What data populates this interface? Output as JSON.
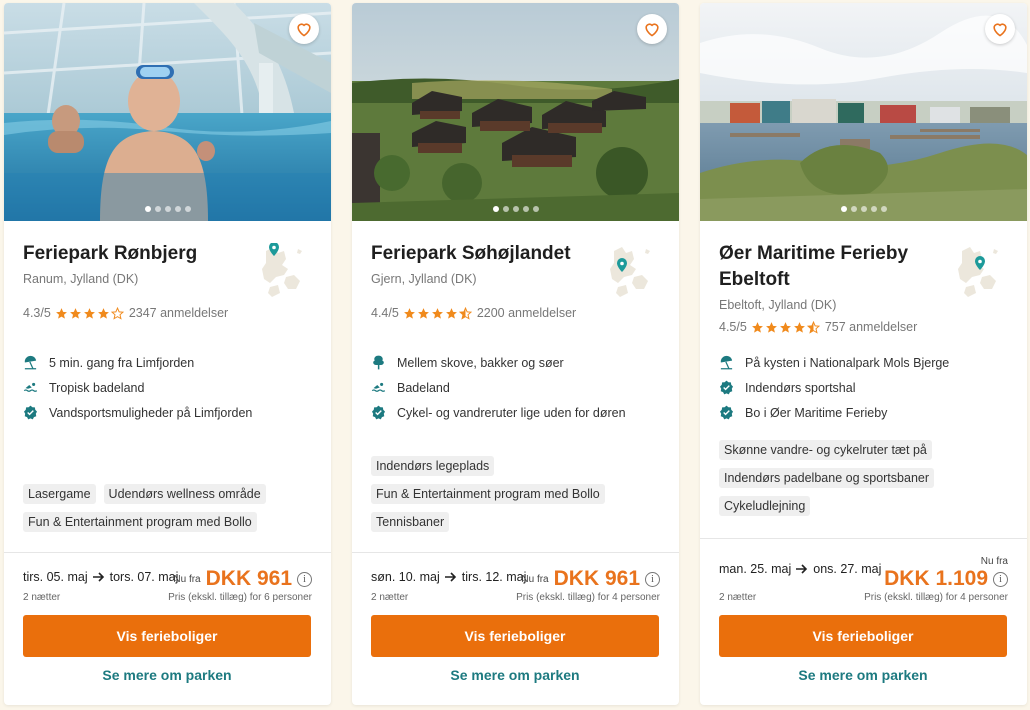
{
  "colors": {
    "accent": "#ea6f0c",
    "price": "#e9731d",
    "link": "#1d7a80",
    "icon": "#1d7a80",
    "star": "#f08a1c"
  },
  "cards": [
    {
      "title": "Feriepark Rønbjerg",
      "location": "Ranum, Jylland (DK)",
      "rating": "4.3/5",
      "stars": 4.3,
      "reviews": "2347 anmeldelser",
      "image_index": 1,
      "image_count": 5,
      "features": [
        {
          "icon": "beach-umbrella-icon",
          "text": "5 min. gang fra Limfjorden"
        },
        {
          "icon": "swimmer-icon",
          "text": "Tropisk badeland"
        },
        {
          "icon": "badge-check-icon",
          "text": "Vandsportsmuligheder på Limfjorden"
        }
      ],
      "tags": [
        "Lasergame",
        "Udendørs wellness område",
        "Fun & Entertainment program med Bollo"
      ],
      "dates": {
        "from": "tirs. 05. maj",
        "to": "tors. 07. maj"
      },
      "nights": "2 nætter",
      "nu_fra": "Nu fra",
      "price": "DKK 961",
      "price_note": "Pris (ekskl. tillæg) for 6 personer",
      "cta": "Vis ferieboliger",
      "more": "Se mere om parken"
    },
    {
      "title": "Feriepark Søhøjlandet",
      "location": "Gjern, Jylland (DK)",
      "rating": "4.4/5",
      "stars": 4.4,
      "reviews": "2200 anmeldelser",
      "image_index": 1,
      "image_count": 5,
      "features": [
        {
          "icon": "tree-icon",
          "text": "Mellem skove, bakker og søer"
        },
        {
          "icon": "swimmer-icon",
          "text": "Badeland"
        },
        {
          "icon": "badge-check-icon",
          "text": "Cykel- og vandreruter lige uden for døren"
        }
      ],
      "tags": [
        "Indendørs legeplads",
        "Fun & Entertainment program med Bollo",
        "Tennisbaner"
      ],
      "dates": {
        "from": "søn. 10. maj",
        "to": "tirs. 12. maj"
      },
      "nights": "2 nætter",
      "nu_fra": "Nu fra",
      "price": "DKK 961",
      "price_note": "Pris (ekskl. tillæg) for 4 personer",
      "cta": "Vis ferieboliger",
      "more": "Se mere om parken"
    },
    {
      "title": "Øer Maritime Ferieby Ebeltoft",
      "location": "Ebeltoft, Jylland (DK)",
      "rating": "4.5/5",
      "stars": 4.5,
      "reviews": "757 anmeldelser",
      "image_index": 1,
      "image_count": 5,
      "features": [
        {
          "icon": "beach-umbrella-icon",
          "text": "På kysten i Nationalpark Mols Bjerge"
        },
        {
          "icon": "badge-check-icon",
          "text": "Indendørs sportshal"
        },
        {
          "icon": "badge-check-icon",
          "text": "Bo i Øer Maritime Ferieby"
        }
      ],
      "tags": [
        "Skønne vandre- og cykelruter tæt på",
        "Indendørs padelbane og sportsbaner",
        "Cykeludlejning"
      ],
      "dates": {
        "from": "man. 25. maj",
        "to": "ons. 27. maj"
      },
      "nights": "2 nætter",
      "nu_fra": "Nu fra",
      "price": "DKK 1.109",
      "price_note": "Pris (ekskl. tillæg) for 4 personer",
      "cta": "Vis ferieboliger",
      "more": "Se mere om parken"
    }
  ]
}
